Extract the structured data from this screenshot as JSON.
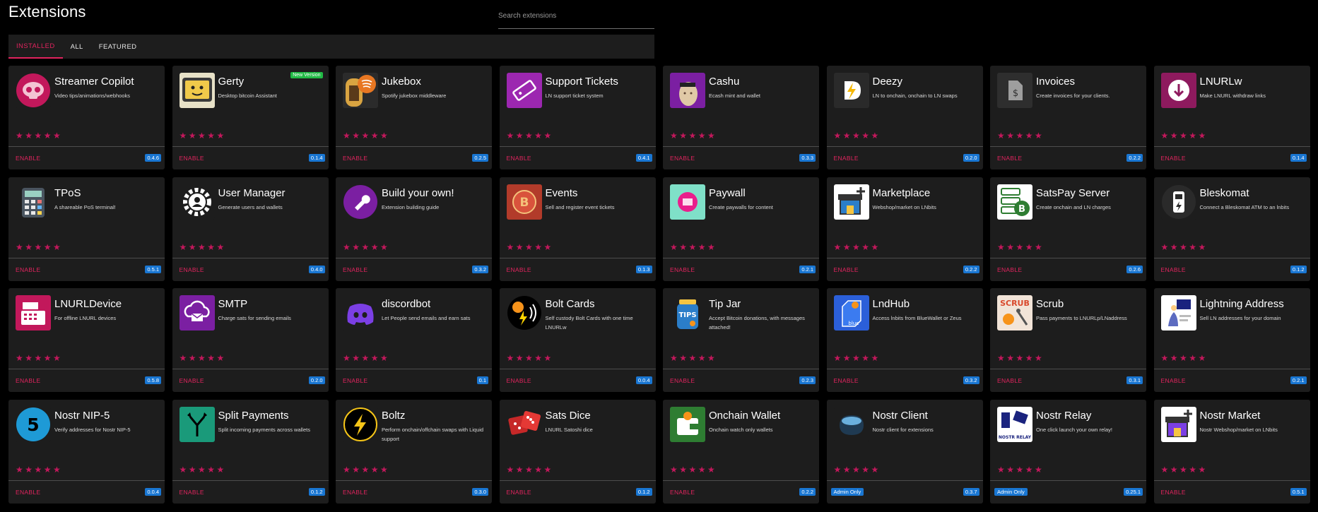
{
  "header": {
    "title": "Extensions"
  },
  "search": {
    "placeholder": "Search extensions"
  },
  "tabs": [
    {
      "label": "INSTALLED",
      "active": true
    },
    {
      "label": "ALL",
      "active": false
    },
    {
      "label": "FEATURED",
      "active": false
    }
  ],
  "colors": {
    "accent": "#e0245e",
    "badge": "#1976d2",
    "new_badge": "#21ba45",
    "card_bg": "#1d1d1d"
  },
  "extensions": [
    {
      "name": "Streamer Copilot",
      "desc": "Video tips/animations/webhooks",
      "version": "0.4.6",
      "action": "ENABLE",
      "icon": "copilot-icon"
    },
    {
      "name": "Gerty",
      "desc": "Desktop bitcoin Assistant",
      "version": "0.1.4",
      "action": "ENABLE",
      "badge": "New Version",
      "icon": "gerty-icon"
    },
    {
      "name": "Jukebox",
      "desc": "Spotify jukebox middleware",
      "version": "0.2.5",
      "action": "ENABLE",
      "icon": "jukebox-icon"
    },
    {
      "name": "Support Tickets",
      "desc": "LN support ticket system",
      "version": "0.4.1",
      "action": "ENABLE",
      "icon": "ticket-icon"
    },
    {
      "name": "Cashu",
      "desc": "Ecash mint and wallet",
      "version": "0.3.3",
      "action": "ENABLE",
      "icon": "cashu-icon"
    },
    {
      "name": "Deezy",
      "desc": "LN to onchain, onchain to LN swaps",
      "version": "0.2.0",
      "action": "ENABLE",
      "icon": "deezy-icon"
    },
    {
      "name": "Invoices",
      "desc": "Create invoices for your clients.",
      "version": "0.2.2",
      "action": "ENABLE",
      "icon": "invoice-icon"
    },
    {
      "name": "LNURLw",
      "desc": "Make LNURL withdraw links",
      "version": "0.1.4",
      "action": "ENABLE",
      "icon": "withdraw-icon"
    },
    {
      "name": "TPoS",
      "desc": "A shareable PoS terminal!",
      "version": "0.5.1",
      "action": "ENABLE",
      "icon": "calculator-icon"
    },
    {
      "name": "User Manager",
      "desc": "Generate users and wallets",
      "version": "0.4.0",
      "action": "ENABLE",
      "icon": "user-gear-icon"
    },
    {
      "name": "Build your own!",
      "desc": "Extension building guide",
      "version": "0.3.2",
      "action": "ENABLE",
      "icon": "wrench-icon"
    },
    {
      "name": "Events",
      "desc": "Sell and register event tickets",
      "version": "0.1.3",
      "action": "ENABLE",
      "icon": "events-icon"
    },
    {
      "name": "Paywall",
      "desc": "Create paywalls for content",
      "version": "0.2.1",
      "action": "ENABLE",
      "icon": "paywall-icon"
    },
    {
      "name": "Marketplace",
      "desc": "Webshop/market on LNbits",
      "version": "0.2.2",
      "action": "ENABLE",
      "icon": "shop-icon"
    },
    {
      "name": "SatsPay Server",
      "desc": "Create onchain and LN charges",
      "version": "0.2.6",
      "action": "ENABLE",
      "icon": "server-icon"
    },
    {
      "name": "Bleskomat",
      "desc": "Connect a Bleskomat ATM to an lnbits",
      "version": "0.1.2",
      "action": "ENABLE",
      "icon": "atm-icon"
    },
    {
      "name": "LNURLDevice",
      "desc": "For offline LNURL devices",
      "version": "0.5.8",
      "action": "ENABLE",
      "icon": "register-icon"
    },
    {
      "name": "SMTP",
      "desc": "Charge sats for sending emails",
      "version": "0.2.0",
      "action": "ENABLE",
      "icon": "cloud-mail-icon"
    },
    {
      "name": "discordbot",
      "desc": "Let People send emails and earn sats",
      "version": "0.1",
      "action": "ENABLE",
      "icon": "discord-icon"
    },
    {
      "name": "Bolt Cards",
      "desc": "Self custody Bolt Cards with one time LNURLw",
      "version": "0.0.4",
      "action": "ENABLE",
      "icon": "boltcard-icon"
    },
    {
      "name": "Tip Jar",
      "desc": "Accept Bitcoin donations, with messages attached!",
      "version": "0.2.3",
      "action": "ENABLE",
      "icon": "tipjar-icon"
    },
    {
      "name": "LndHub",
      "desc": "Access lnbits from BlueWallet or Zeus",
      "version": "0.3.2",
      "action": "ENABLE",
      "icon": "lndhub-icon"
    },
    {
      "name": "Scrub",
      "desc": "Pass payments to LNURLp/LNaddress",
      "version": "0.3.1",
      "action": "ENABLE",
      "icon": "scrub-icon"
    },
    {
      "name": "Lightning Address",
      "desc": "Sell LN addresses for your domain",
      "version": "0.2.1",
      "action": "ENABLE",
      "icon": "address-icon"
    },
    {
      "name": "Nostr NIP-5",
      "desc": "Verify addresses for Nostr NIP-5",
      "version": "0.0.4",
      "action": "ENABLE",
      "icon": "nip5-icon"
    },
    {
      "name": "Split Payments",
      "desc": "Split incoming payments across wallets",
      "version": "0.1.2",
      "action": "ENABLE",
      "icon": "split-icon"
    },
    {
      "name": "Boltz",
      "desc": "Perform onchain/offchain swaps with Liquid support",
      "version": "0.3.0",
      "action": "ENABLE",
      "icon": "bolt-icon"
    },
    {
      "name": "Sats Dice",
      "desc": "LNURL Satoshi dice",
      "version": "0.1.2",
      "action": "ENABLE",
      "icon": "dice-icon"
    },
    {
      "name": "Onchain Wallet",
      "desc": "Onchain watch only wallets",
      "version": "0.2.2",
      "action": "ENABLE",
      "icon": "wallet-icon"
    },
    {
      "name": "Nostr Client",
      "desc": "Nostr client for extensions",
      "version": "0.3.7",
      "action": "Admin Only",
      "icon": "nostr-client-icon"
    },
    {
      "name": "Nostr Relay",
      "desc": "One click launch your own relay!",
      "version": "0.25.1",
      "action": "Admin Only",
      "icon": "relay-icon"
    },
    {
      "name": "Nostr Market",
      "desc": "Nostr Webshop/market on LNbits",
      "version": "0.5.1",
      "action": "ENABLE",
      "icon": "nostr-market-icon"
    }
  ]
}
